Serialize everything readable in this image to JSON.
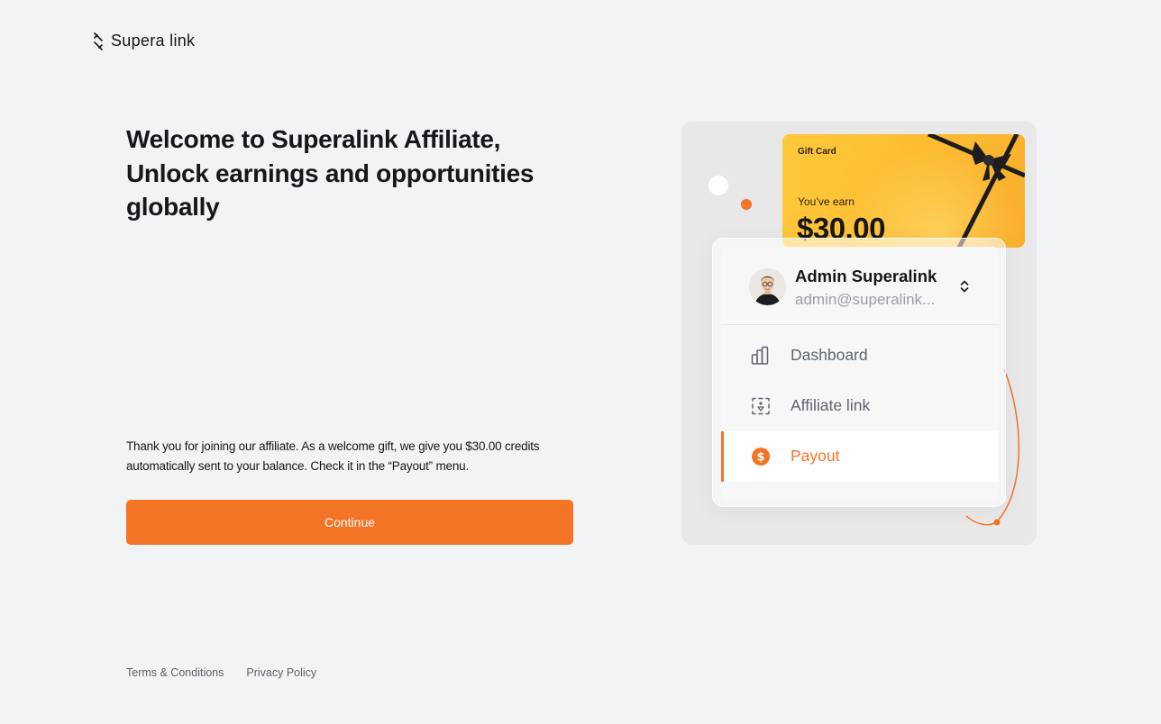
{
  "brand": {
    "name": "Supera link",
    "accent_color": "#f37425"
  },
  "main": {
    "headline_lines": [
      "Welcome to Superalink Affiliate,",
      "Unlock earnings and opportunities",
      "globally"
    ],
    "description_lines": [
      "Thank you for joining our affiliate. As a welcome gift, we give you $30.00 credits",
      "automatically sent to your balance. Check it in the “Payout” menu."
    ],
    "continue_label": "Continue"
  },
  "footer": {
    "terms_label": "Terms & Conditions",
    "privacy_label": "Privacy Policy"
  },
  "illustration": {
    "gift_card": {
      "title": "Gift Card",
      "earn_label": "You’ve earn",
      "amount": "$30.00",
      "color": "#fdbd33"
    },
    "profile": {
      "name": "Admin Superalink",
      "email": "admin@superalink..."
    },
    "nav_items": [
      {
        "label": "Dashboard",
        "icon": "bar-chart-icon",
        "active": false
      },
      {
        "label": "Affiliate link",
        "icon": "share-icon",
        "active": false
      },
      {
        "label": "Payout",
        "icon": "dollar-icon",
        "active": true
      }
    ]
  }
}
